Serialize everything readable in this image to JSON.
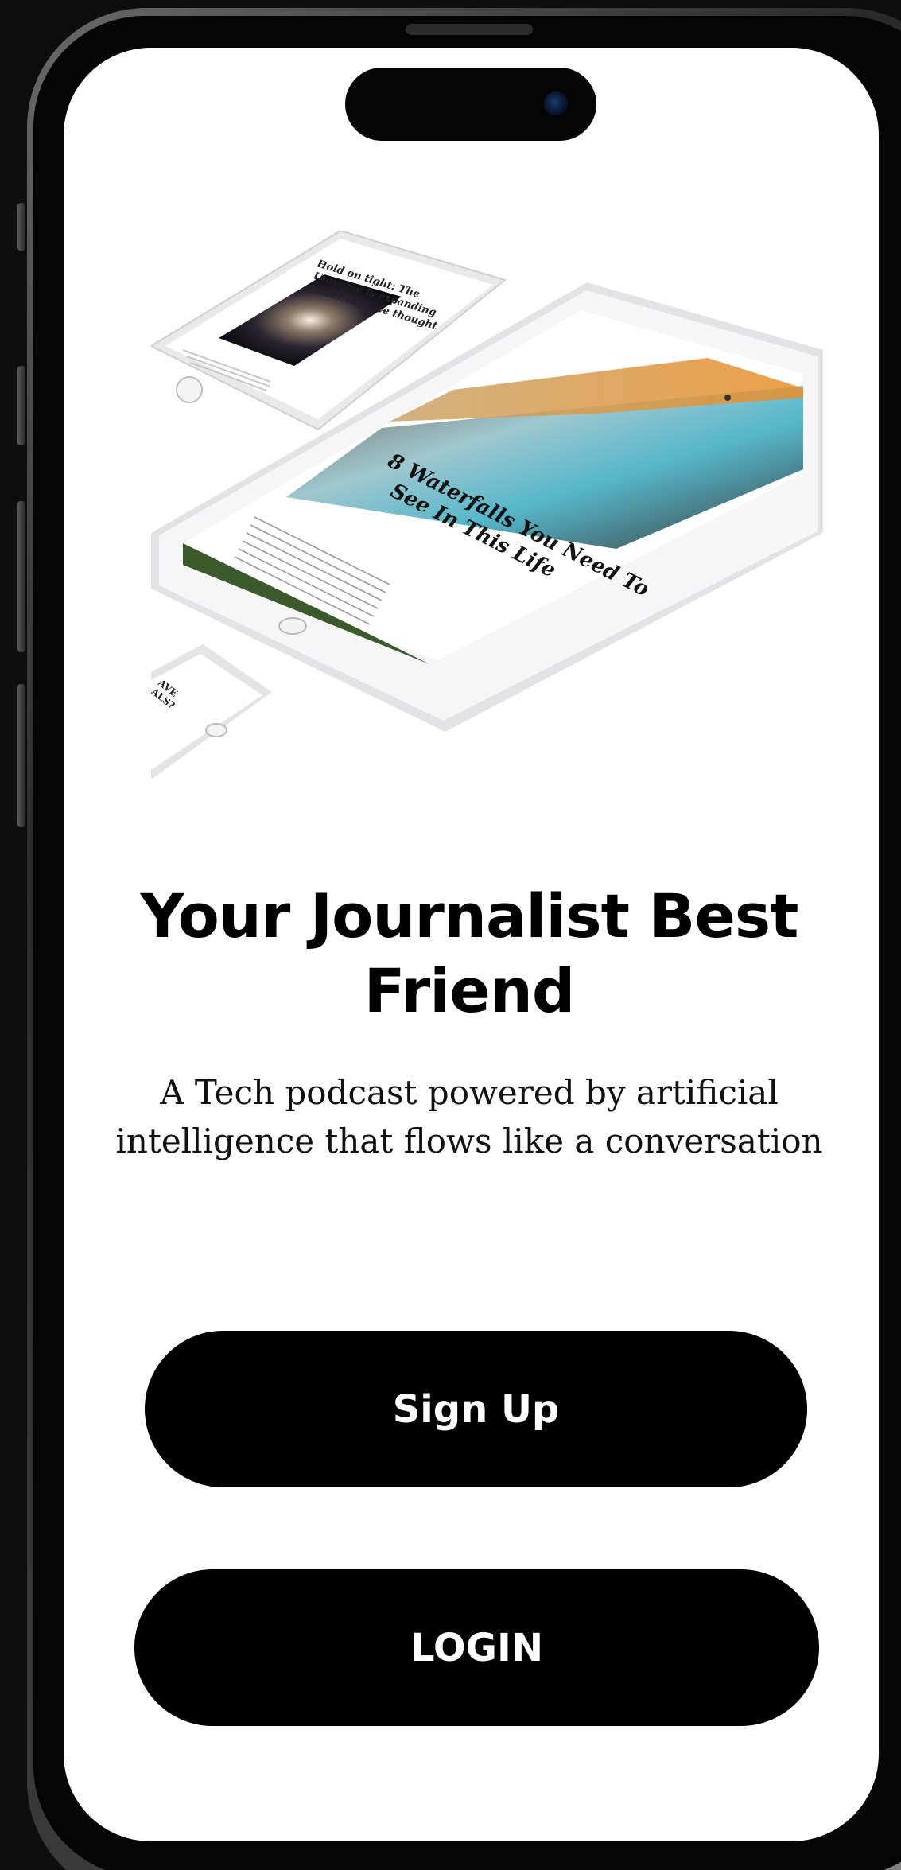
{
  "onboarding": {
    "headline": "Your Journalist Best Friend",
    "subtitle": "A Tech podcast powered by artificial intelligence that flows like a conversation",
    "signup_label": "Sign Up",
    "login_label": "LOGIN"
  },
  "hero": {
    "tablet_headline_line1": "8 Waterfalls You Need To",
    "tablet_headline_line2": "See In This Life",
    "phone_headline_line1": "Hold on tight: The",
    "phone_headline_line2": "Universe is expanding",
    "phone_headline_line3": "faster than we thought",
    "phone2_headline_line1": "AVE",
    "phone2_headline_line2": "ALS?"
  },
  "colors": {
    "button_background": "#000000",
    "button_text": "#ffffff",
    "screen_background": "#ffffff",
    "frame_background": "#0e0e0e"
  }
}
